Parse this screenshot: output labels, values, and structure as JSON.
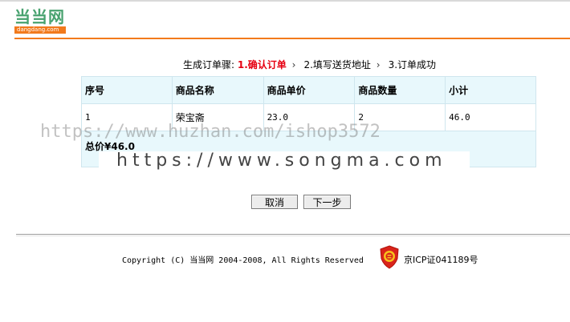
{
  "header": {
    "logo_text": "当当网",
    "logo_sub": "dangdang.com",
    "brand_orange": "#f27a1c",
    "brand_green": "#48a26f"
  },
  "steps": {
    "prefix": "生成订单骤:",
    "items": [
      {
        "label": "1.确认订单",
        "current": true
      },
      {
        "label": "2.填写送货地址",
        "current": false
      },
      {
        "label": "3.订单成功",
        "current": false
      }
    ]
  },
  "table": {
    "columns": [
      "序号",
      "商品名称",
      "商品单价",
      "商品数量",
      "小计"
    ],
    "rows": [
      [
        "1",
        "荣宝斋",
        "23.0",
        "2",
        "46.0"
      ]
    ],
    "total": "总价¥46.0"
  },
  "watermarks": {
    "line1": "https://www.huzhan.com/ishop3572",
    "line2": "https://www.songma.com"
  },
  "buttons": {
    "cancel": "取消",
    "next": "下一步"
  },
  "footer": {
    "copyright": "Copyright (C) 当当网 2004-2008, All Rights Reserved",
    "icp": "京ICP证041189号",
    "badge_icon": "police-badge-icon"
  }
}
